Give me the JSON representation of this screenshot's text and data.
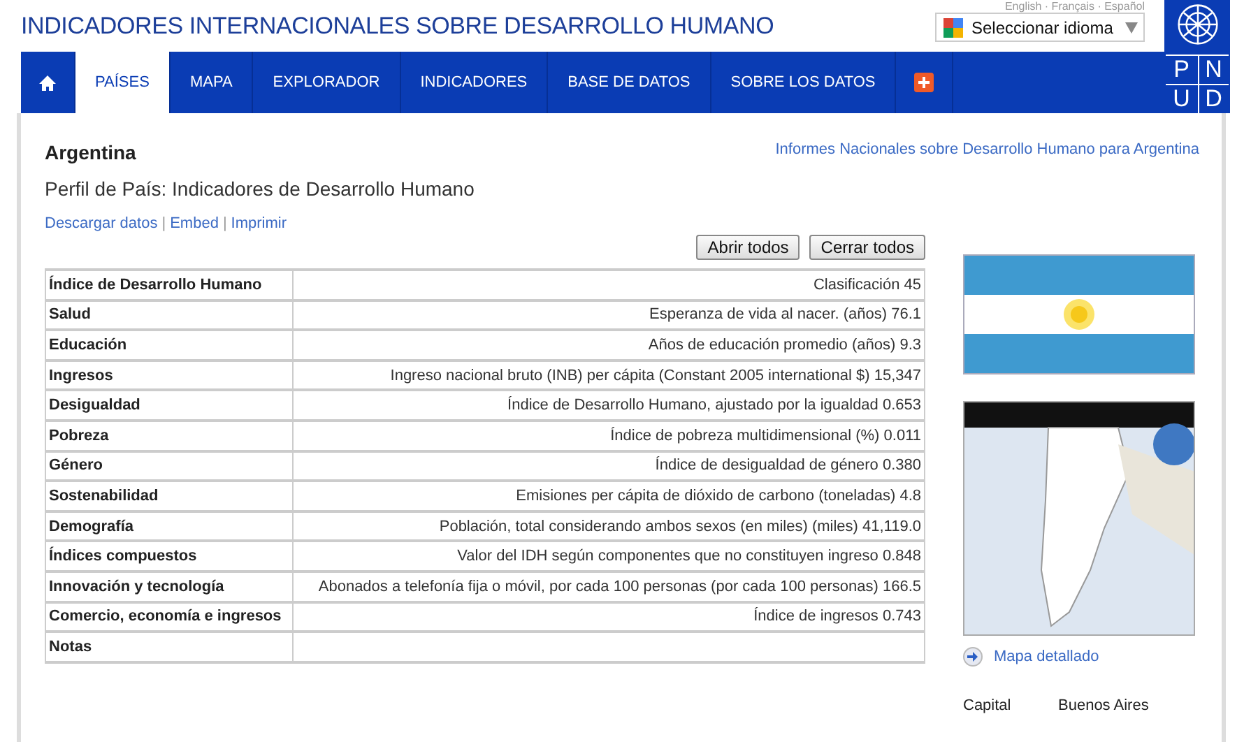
{
  "header": {
    "title": "INDICADORES INTERNACIONALES SOBRE DESARROLLO HUMANO",
    "languages": "English · Français · Español",
    "language_select": "Seleccionar idioma",
    "logo_letters": [
      "P",
      "N",
      "U",
      "D"
    ]
  },
  "nav": {
    "tabs": [
      {
        "label": "PAÍSES",
        "selected": true
      },
      {
        "label": "MAPA",
        "selected": false
      },
      {
        "label": "EXPLORADOR",
        "selected": false
      },
      {
        "label": "INDICADORES",
        "selected": false
      },
      {
        "label": "BASE DE DATOS",
        "selected": false
      },
      {
        "label": "SOBRE LOS DATOS",
        "selected": false
      }
    ]
  },
  "profile": {
    "country": "Argentina",
    "subtitle": "Perfil de País: Indicadores de Desarrollo Humano",
    "reports_link": "Informes Nacionales sobre Desarrollo Humano para Argentina",
    "links": [
      "Descargar datos",
      "Embed",
      "Imprimir"
    ],
    "link_separator": "|",
    "buttons": [
      "Abrir todos",
      "Cerrar todos"
    ]
  },
  "table": {
    "rows": [
      {
        "label": "Índice de Desarrollo Humano",
        "value": "Clasificación 45"
      },
      {
        "label": "Salud",
        "value": "Esperanza de vida al nacer. (años) 76.1"
      },
      {
        "label": "Educación",
        "value": "Años de educación promedio (años) 9.3"
      },
      {
        "label": "Ingresos",
        "value": "Ingreso nacional bruto (INB) per cápita (Constant 2005 international $) 15,347"
      },
      {
        "label": "Desigualdad",
        "value": "Índice de Desarrollo Humano, ajustado por la igualdad 0.653"
      },
      {
        "label": "Pobreza",
        "value": "Índice de pobreza multidimensional (%) 0.011"
      },
      {
        "label": "Género",
        "value": "Índice de desigualdad de género 0.380"
      },
      {
        "label": "Sostenabilidad",
        "value": "Emisiones per cápita de dióxido de carbono (toneladas) 4.8"
      },
      {
        "label": "Demografía",
        "value": "Población, total considerando ambos sexos (en miles) (miles) 41,119.0"
      },
      {
        "label": "Índices compuestos",
        "value": "Valor del IDH según componentes que no constituyen ingreso 0.848"
      },
      {
        "label": "Innovación y tecnología",
        "value": "Abonados a telefonía fija o móvil, por cada 100 personas (por cada 100 personas) 166.5"
      },
      {
        "label": "Comercio, economía e ingresos",
        "value": "Índice de ingresos 0.743"
      },
      {
        "label": "Notas"
      }
    ]
  },
  "sidebar": {
    "map_link": "Mapa detallado",
    "facts": [
      {
        "label": "Capital",
        "value": "Buenos Aires"
      }
    ]
  }
}
